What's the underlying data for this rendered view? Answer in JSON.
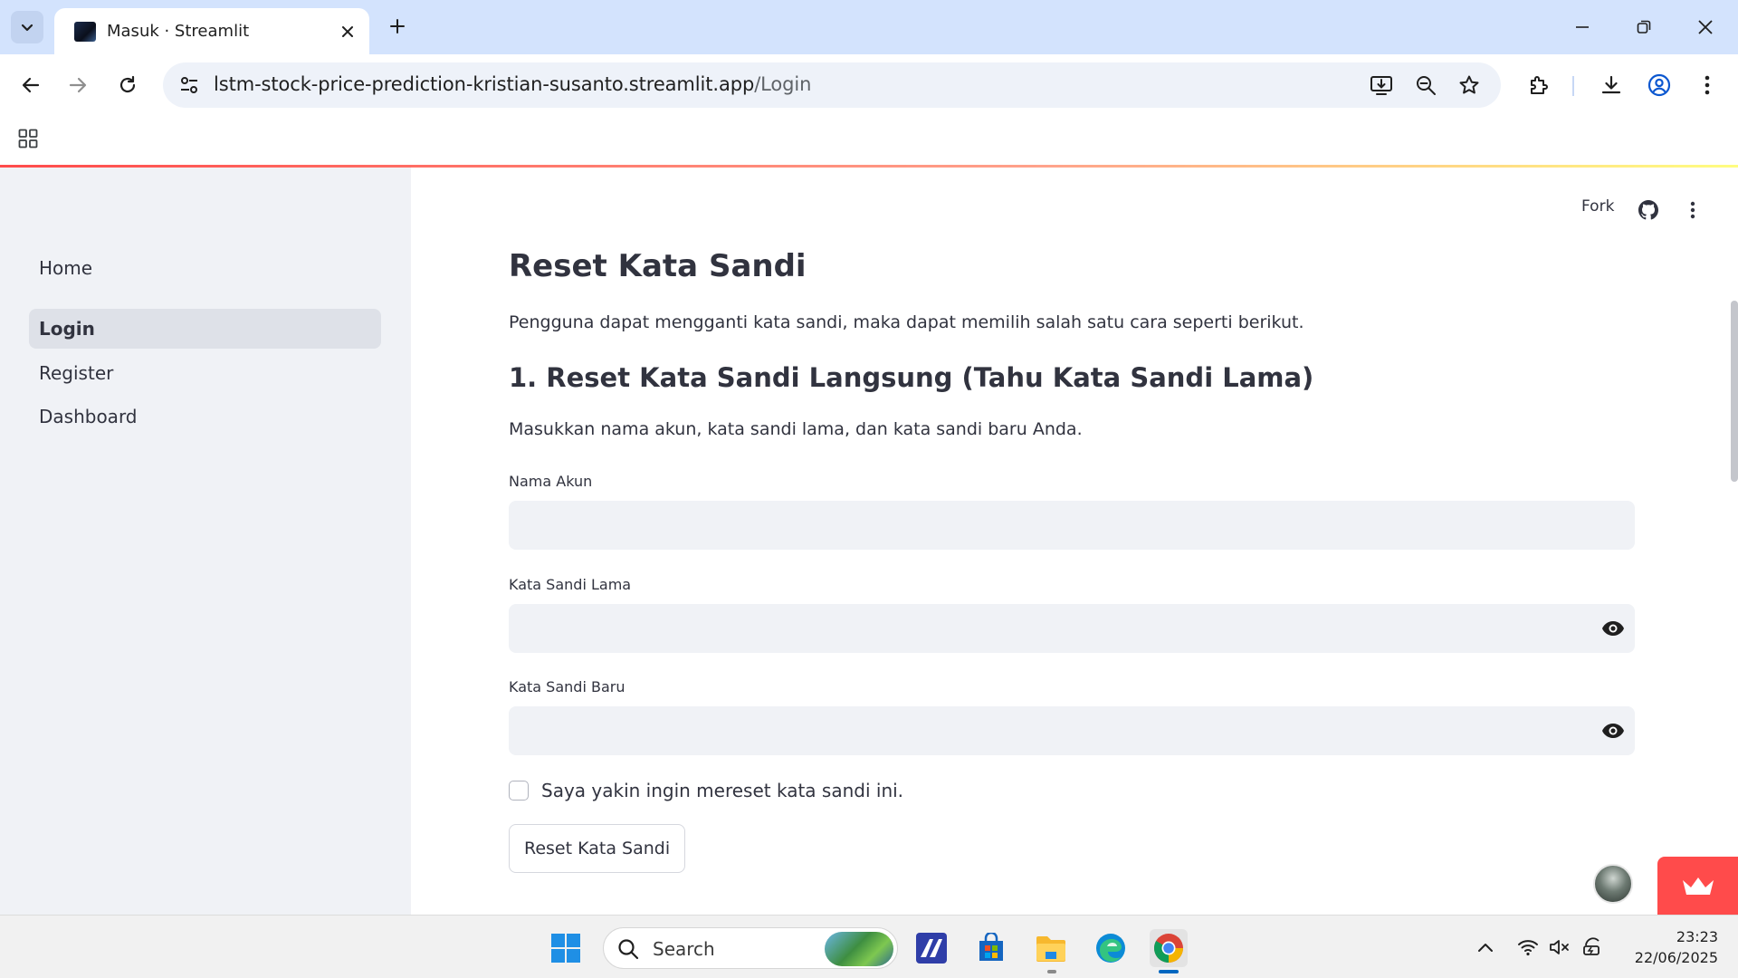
{
  "browser": {
    "tab_title": "Masuk · Streamlit",
    "url_host": "lstm-stock-price-prediction-kristian-susanto.streamlit.app",
    "url_path": "/Login"
  },
  "sidebar": {
    "items": [
      {
        "label": "Home",
        "active": false
      },
      {
        "label": "Login",
        "active": true
      },
      {
        "label": "Register",
        "active": false
      },
      {
        "label": "Dashboard",
        "active": false
      }
    ]
  },
  "header": {
    "fork_label": "Fork"
  },
  "main": {
    "title": "Reset Kata Sandi",
    "intro": "Pengguna dapat mengganti kata sandi, maka dapat memilih salah satu cara seperti berikut.",
    "section_title": "1. Reset Kata Sandi Langsung (Tahu Kata Sandi Lama)",
    "section_desc": "Masukkan nama akun, kata sandi lama, dan kata sandi baru Anda.",
    "fields": [
      {
        "label": "Nama Akun",
        "value": ""
      },
      {
        "label": "Kata Sandi Lama",
        "value": ""
      },
      {
        "label": "Kata Sandi Baru",
        "value": ""
      }
    ],
    "confirm_checkbox_label": "Saya yakin ingin mereset kata sandi ini.",
    "confirm_checked": false,
    "submit_label": "Reset Kata Sandi"
  },
  "taskbar": {
    "search_label": "Search",
    "time": "23:23",
    "date": "22/06/2025"
  },
  "colors": {
    "accent": "#ff4b4b",
    "sidebar_bg": "#f0f2f6",
    "tabstrip_bg": "#d3e3fd",
    "text": "#31333f"
  }
}
